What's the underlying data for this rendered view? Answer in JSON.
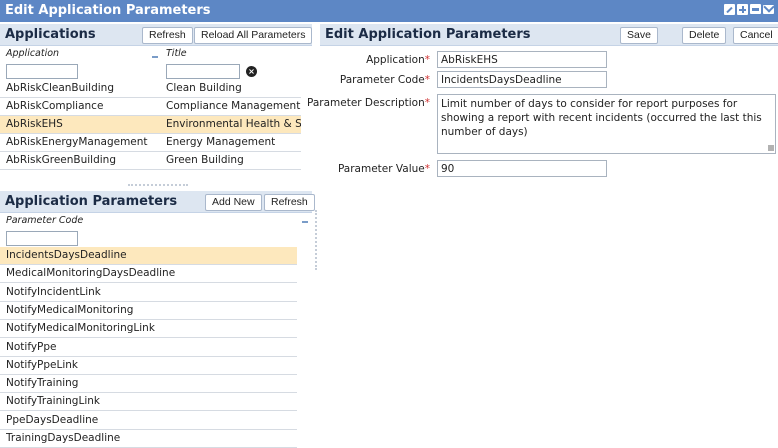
{
  "window": {
    "title": "Edit Application Parameters",
    "icons": [
      "edit-icon",
      "add-icon",
      "print-icon",
      "mail-icon"
    ]
  },
  "applications": {
    "title": "Applications",
    "refresh_label": "Refresh",
    "reload_label": "Reload All Parameters",
    "col_application": "Application",
    "col_title": "Title",
    "rows": [
      {
        "app": "AbRiskCleanBuilding",
        "title": "Clean Building"
      },
      {
        "app": "AbRiskCompliance",
        "title": "Compliance Management"
      },
      {
        "app": "AbRiskEHS",
        "title": "Environmental Health & Safety"
      },
      {
        "app": "AbRiskEnergyManagement",
        "title": "Energy Management"
      },
      {
        "app": "AbRiskGreenBuilding",
        "title": "Green Building"
      }
    ],
    "selected_index": 2
  },
  "app_params": {
    "title": "Application Parameters",
    "add_new_label": "Add New",
    "refresh_label": "Refresh",
    "col_parameter_code": "Parameter Code",
    "rows": [
      "IncidentsDaysDeadline",
      "MedicalMonitoringDaysDeadline",
      "NotifyIncidentLink",
      "NotifyMedicalMonitoring",
      "NotifyMedicalMonitoringLink",
      "NotifyPpe",
      "NotifyPpeLink",
      "NotifyTraining",
      "NotifyTrainingLink",
      "PpeDaysDeadline",
      "TrainingDaysDeadline"
    ],
    "selected_index": 0
  },
  "edit": {
    "title": "Edit Application Parameters",
    "save_label": "Save",
    "delete_label": "Delete",
    "cancel_label": "Cancel",
    "required_mark": "*",
    "application_label": "Application",
    "application_value": "AbRiskEHS",
    "parameter_code_label": "Parameter Code",
    "parameter_code_value": "IncidentsDaysDeadline",
    "description_label": "Parameter Description",
    "description_value": "Limit number of days to consider for report purposes for showing a report with recent incidents (occurred the last this number of days)",
    "parameter_value_label": "Parameter Value",
    "parameter_value_value": "90"
  },
  "colors": {
    "titlebar": "#5d87c5",
    "header_bg": "#dde6f1",
    "selected_row": "#fde8bd",
    "required": "#d03030"
  }
}
